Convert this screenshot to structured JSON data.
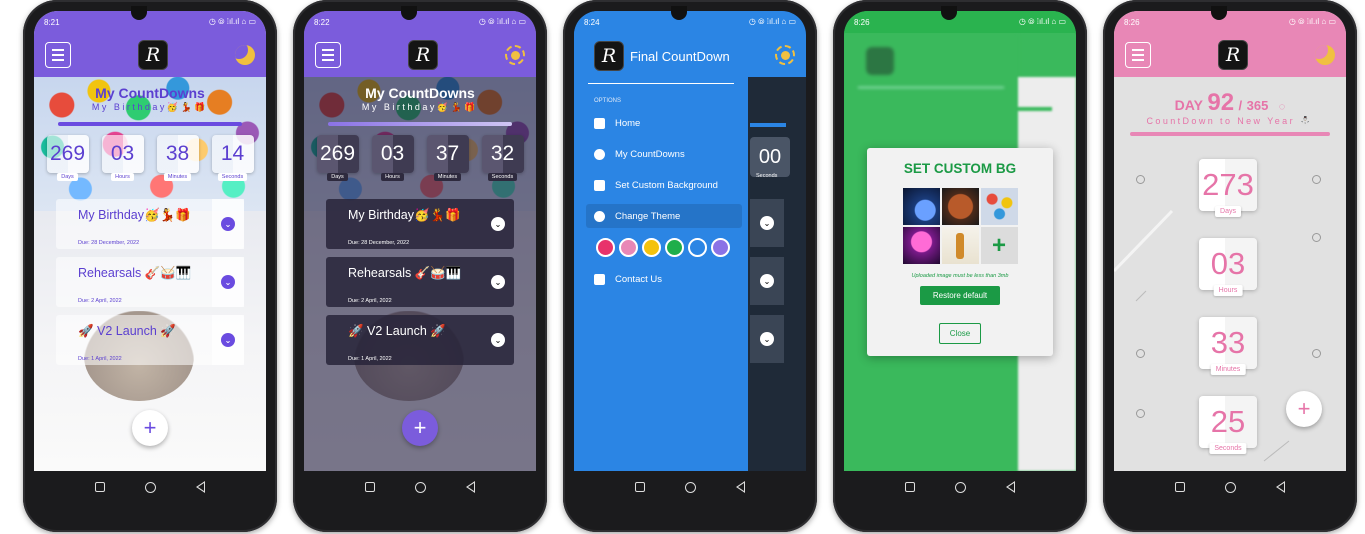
{
  "status": {
    "phone1_time": "8:21",
    "phone2_time": "8:22",
    "phone3_time": "8:24",
    "phone4_time": "8:26",
    "phone5_time": "8:26",
    "right_icons": "◷ ⦾ ⁞ıl.ıl ⌂ ▭"
  },
  "app": {
    "logo_letter": "R",
    "drawer_title": "Final CountDown"
  },
  "main": {
    "title": "My CountDowns",
    "subtitle": "My Birthday🥳💃🎁",
    "tiles": [
      {
        "label": "Days",
        "p1": "269",
        "p2": "269"
      },
      {
        "label": "Hours",
        "p1": "03",
        "p2": "03"
      },
      {
        "label": "Minutes",
        "p1": "38",
        "p2": "37"
      },
      {
        "label": "Seconds",
        "p1": "14",
        "p2": "32"
      }
    ],
    "countdowns": [
      {
        "name": "My Birthday🥳💃🎁",
        "due": "Due: 28 December, 2022"
      },
      {
        "name": "Rehearsals 🎸🥁🎹",
        "due": "Due: 2 April, 2022"
      },
      {
        "name": "🚀 V2 Launch 🚀",
        "due": "Due: 1 April, 2022"
      }
    ],
    "fab": "+",
    "behind_drawer_num": "00",
    "behind_drawer_lbl": "Seconds"
  },
  "drawer": {
    "section": "OPTIONS",
    "items": [
      "Home",
      "My CountDowns",
      "Set Custom Background",
      "Change Theme",
      "Contact Us"
    ],
    "theme_colors": [
      "#e8336b",
      "#e887b6",
      "#f4c20d",
      "#1fae4b",
      "#2b85e4",
      "#8a72e6"
    ]
  },
  "modal": {
    "title": "SET CUSTOM BG",
    "add": "+",
    "note": "Uploaded image must be less than 3mb",
    "restore": "Restore default",
    "close": "Close"
  },
  "year": {
    "day_prefix": "DAY",
    "day": "92",
    "sep": "/",
    "total": "365",
    "subtitle": "CountDown to New Year ⛄",
    "tiles": [
      {
        "num": "273",
        "label": "Days"
      },
      {
        "num": "03",
        "label": "Hours"
      },
      {
        "num": "33",
        "label": "Minutes"
      },
      {
        "num": "25",
        "label": "Seconds"
      }
    ]
  },
  "colors": {
    "purple": "#7b5cdc",
    "blue": "#2b85e4",
    "green": "#1fae4b",
    "pink": "#e887b6"
  }
}
